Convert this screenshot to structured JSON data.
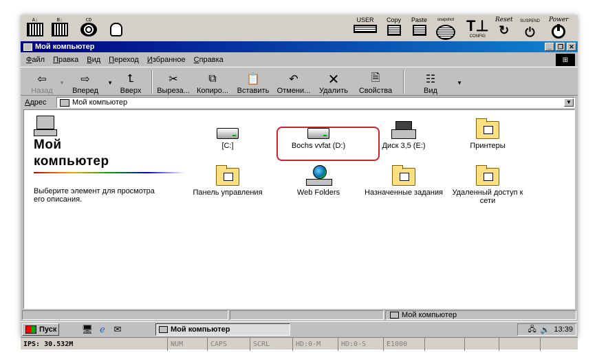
{
  "bochs_toolbar": {
    "left_tools": [
      {
        "caption": "A:",
        "icon": "floppy-a-icon"
      },
      {
        "caption": "B:",
        "icon": "floppy-b-icon"
      },
      {
        "caption": "CD",
        "icon": "cdrom-icon"
      },
      {
        "caption": "",
        "icon": "mouse-icon"
      }
    ],
    "right_tools": [
      {
        "caption": "USER",
        "icon": "keyboard-icon"
      },
      {
        "caption": "Copy",
        "icon": "copy-icon"
      },
      {
        "caption": "Paste",
        "icon": "paste-icon"
      },
      {
        "caption": "snapshot",
        "icon": "camera-icon"
      },
      {
        "caption": "CONFIG",
        "icon": "config-icon"
      },
      {
        "caption": "Reset",
        "icon": "reset-icon"
      },
      {
        "caption": "SUSPEND",
        "icon": "suspend-icon"
      },
      {
        "caption": "Power",
        "icon": "power-icon"
      }
    ]
  },
  "window": {
    "title": "Мой компьютер",
    "menu": [
      "Файл",
      "Правка",
      "Вид",
      "Переход",
      "Избранное",
      "Справка"
    ],
    "toolbar": {
      "back": "Назад",
      "forward": "Вперед",
      "up": "Вверх",
      "cut": "Выреза...",
      "copy": "Копиро...",
      "paste": "Вставить",
      "undo": "Отмени...",
      "delete": "Удалить",
      "properties": "Свойства",
      "view": "Вид"
    },
    "address": {
      "label": "Адрес",
      "value": "Мой компьютер"
    }
  },
  "left_panel": {
    "title_line1": "Мой",
    "title_line2": "компьютер",
    "description": "Выберите элемент для просмотра его описания."
  },
  "items": [
    {
      "label": "[C:]",
      "icon": "hard-drive-icon"
    },
    {
      "label": "Bochs vvfat (D:)",
      "icon": "hard-drive-icon",
      "highlighted": true
    },
    {
      "label": "Диск 3,5 (E:)",
      "icon": "floppy-drive-icon"
    },
    {
      "label": "Принтеры",
      "icon": "printers-folder-icon"
    },
    {
      "label": "Панель управления",
      "icon": "control-panel-icon"
    },
    {
      "label": "Web Folders",
      "icon": "web-folders-icon"
    },
    {
      "label": "Назначенные задания",
      "icon": "scheduled-tasks-icon"
    },
    {
      "label": "Удаленный доступ к сети",
      "icon": "dialup-networking-icon"
    }
  ],
  "statusbar": {
    "location": "Мой компьютер"
  },
  "taskbar": {
    "start": "Пуск",
    "task": "Мой компьютер",
    "clock": "13:39"
  },
  "bochs_status": {
    "ips": "IPS: 30.532M",
    "indicators": [
      "NUM",
      "CAPS",
      "SCRL",
      "HD:0-M",
      "HD:0-S",
      "E1000"
    ]
  },
  "colors": {
    "title_start": "#000080",
    "title_end": "#1084d0",
    "highlight": "#d0202a"
  }
}
